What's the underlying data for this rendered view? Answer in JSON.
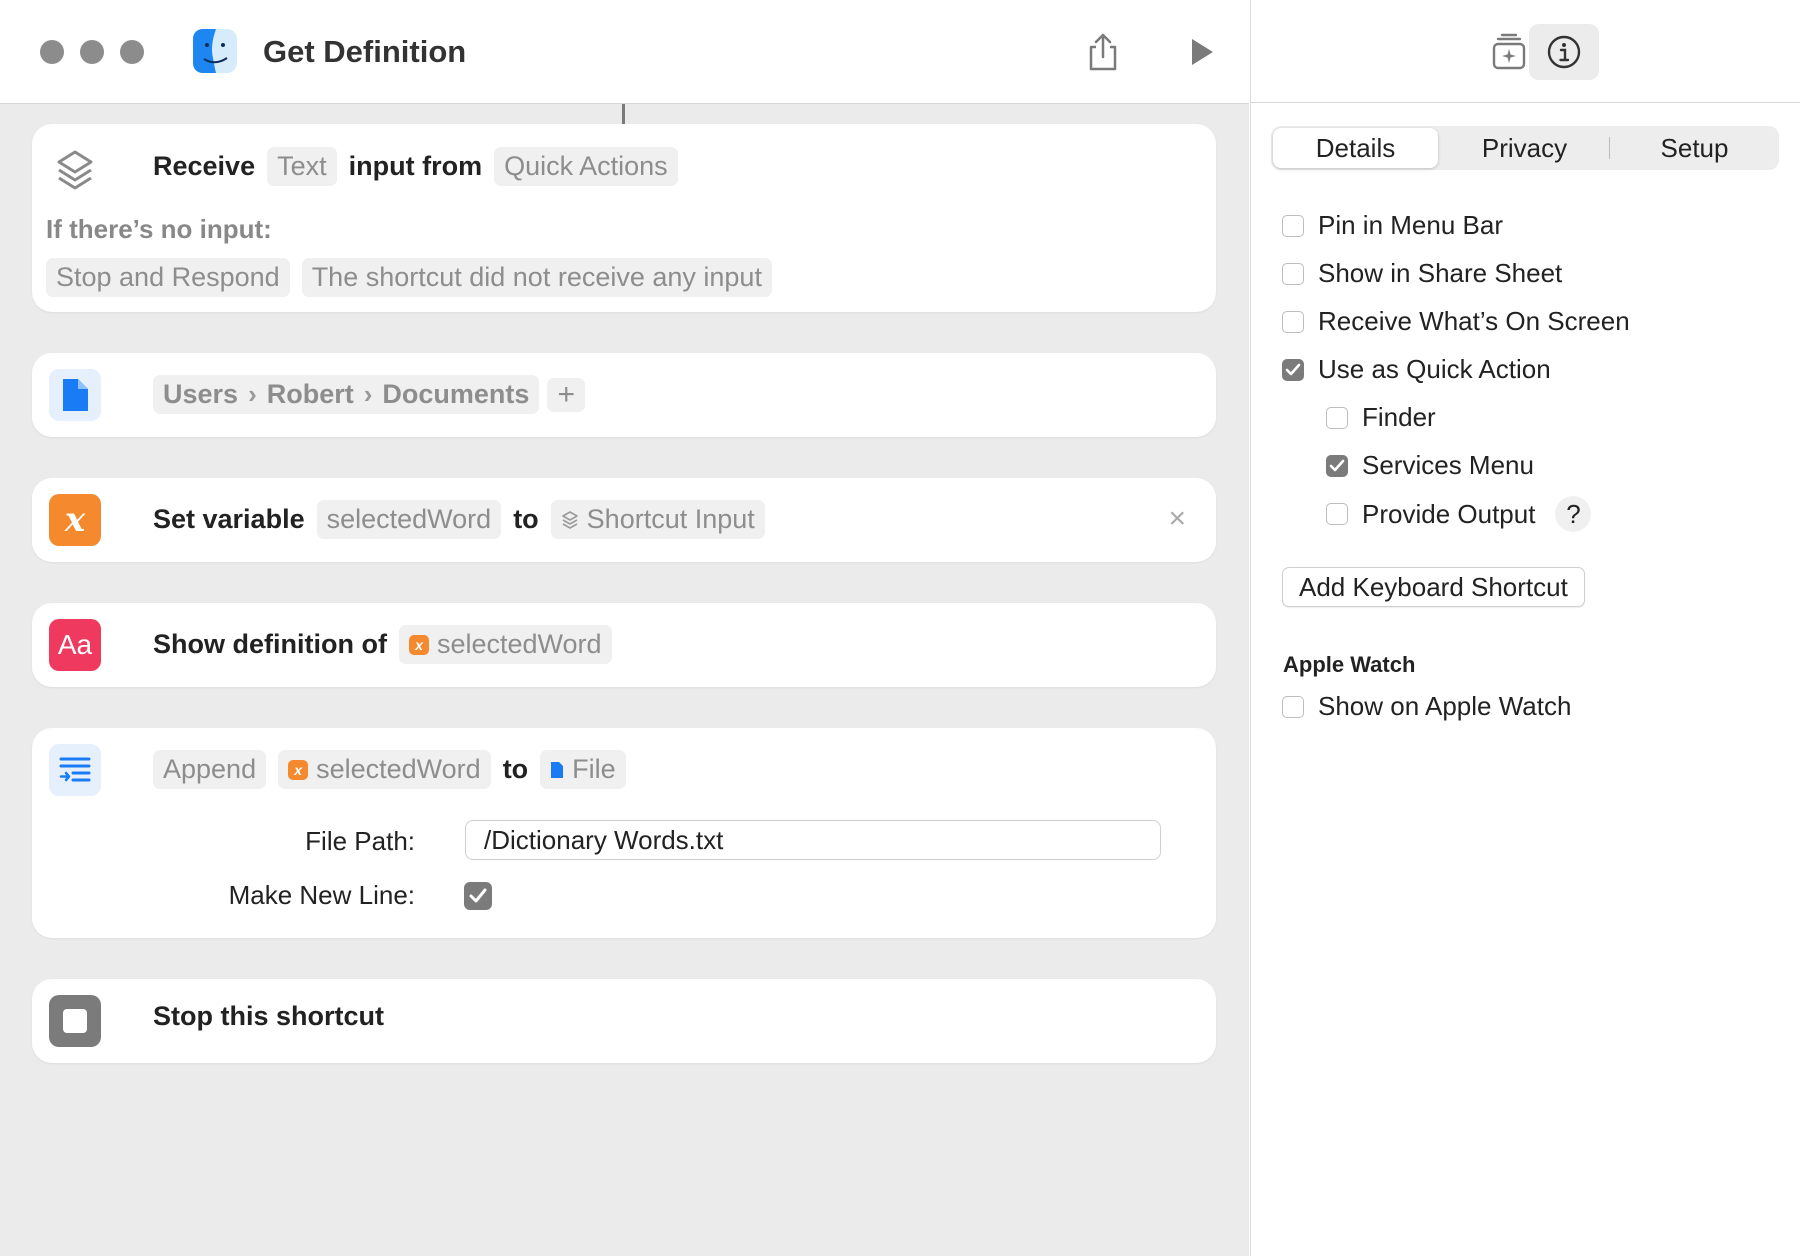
{
  "window": {
    "title": "Get Definition"
  },
  "actions": {
    "receive": {
      "verb": "Receive",
      "type": "Text",
      "middle": "input from",
      "source": "Quick Actions",
      "no_input_label": "If there’s no input:",
      "no_input_action": "Stop and Respond",
      "no_input_message": "The shortcut did not receive any input"
    },
    "file": {
      "path": [
        "Users",
        "Robert",
        "Documents"
      ],
      "add": "+"
    },
    "set_variable": {
      "verb": "Set variable",
      "variable": "selectedWord",
      "to": "to",
      "value": "Shortcut Input",
      "remove": "×"
    },
    "show_definition": {
      "icon_text": "Aa",
      "verb": "Show definition of",
      "variable": "selectedWord"
    },
    "append": {
      "verb": "Append",
      "variable": "selectedWord",
      "to": "to",
      "target": "File",
      "file_path_label": "File Path:",
      "file_path_value": "/Dictionary Words.txt",
      "new_line_label": "Make New Line:",
      "new_line_checked": true
    },
    "stop": {
      "label": "Stop this shortcut"
    }
  },
  "inspector": {
    "tabs": [
      "Details",
      "Privacy",
      "Setup"
    ],
    "active_tab": "Details",
    "options": [
      {
        "label": "Pin in Menu Bar",
        "checked": false
      },
      {
        "label": "Show in Share Sheet",
        "checked": false
      },
      {
        "label": "Receive What’s On Screen",
        "checked": false
      },
      {
        "label": "Use as Quick Action",
        "checked": true
      }
    ],
    "quick_action_options": [
      {
        "label": "Finder",
        "checked": false
      },
      {
        "label": "Services Menu",
        "checked": true
      },
      {
        "label": "Provide Output",
        "checked": false
      }
    ],
    "help_label": "?",
    "keyboard_button": "Add Keyboard Shortcut",
    "apple_watch_title": "Apple Watch",
    "apple_watch_option": {
      "label": "Show on Apple Watch",
      "checked": false
    }
  },
  "colors": {
    "accent_orange": "#f5892e",
    "accent_red": "#f0395f",
    "accent_blue": "#1a7cf5",
    "checkbox_checked": "#7b7b7b"
  }
}
